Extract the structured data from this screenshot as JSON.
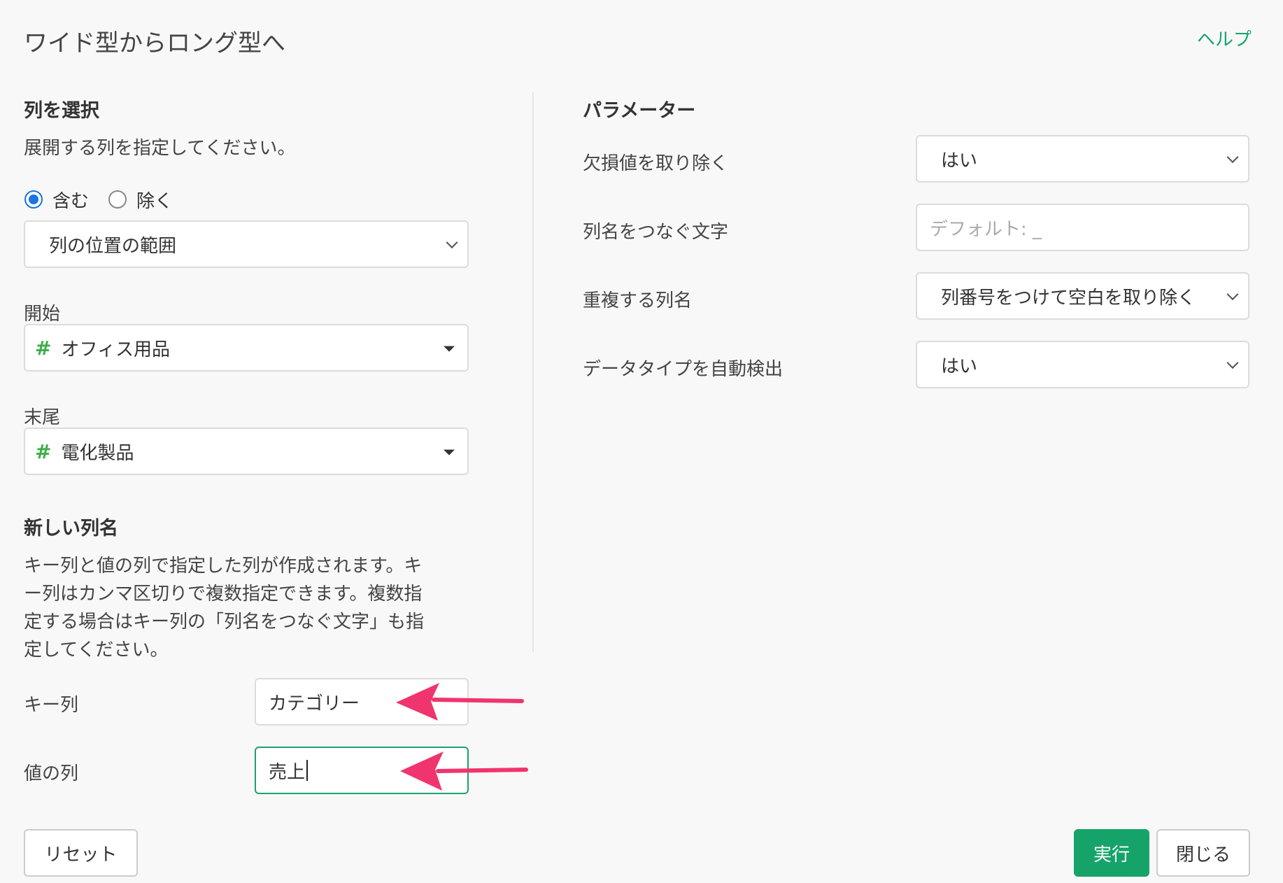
{
  "dialog": {
    "title": "ワイド型からロング型へ",
    "help_label": "ヘルプ"
  },
  "columns": {
    "heading": "列を選択",
    "description": "展開する列を指定してください。",
    "radio": {
      "include_label": "含む",
      "exclude_label": "除く",
      "selected": "include"
    },
    "select_mode": "列の位置の範囲",
    "start_label": "開始",
    "start_value": "オフィス用品",
    "end_label": "末尾",
    "end_value": "電化製品",
    "type_icon_glyph": "#"
  },
  "new_columns": {
    "heading": "新しい列名",
    "description_lines": [
      "キー列と値の列で指定した列が作成されます。キ",
      "ー列はカンマ区切りで複数指定できます。複数指",
      "定する場合はキー列の「列名をつなぐ文字」も指",
      "定してください。"
    ],
    "key_label": "キー列",
    "key_value": "カテゴリー",
    "value_label": "値の列",
    "value_value": "売上"
  },
  "parameters": {
    "heading": "パラメーター",
    "rows": [
      {
        "label": "欠損値を取り除く",
        "value": "はい",
        "kind": "select"
      },
      {
        "label": "列名をつなぐ文字",
        "placeholder": "デフォルト: _",
        "kind": "input"
      },
      {
        "label": "重複する列名",
        "value": "列番号をつけて空白を取り除く",
        "kind": "select"
      },
      {
        "label": "データタイプを自動検出",
        "value": "はい",
        "kind": "select"
      }
    ]
  },
  "buttons": {
    "reset": "リセット",
    "run": "実行",
    "close": "閉じる"
  },
  "colors": {
    "accent": "#16a36a",
    "annotation_arrow": "#f0346e",
    "radio_selected": "#1a73e8"
  }
}
